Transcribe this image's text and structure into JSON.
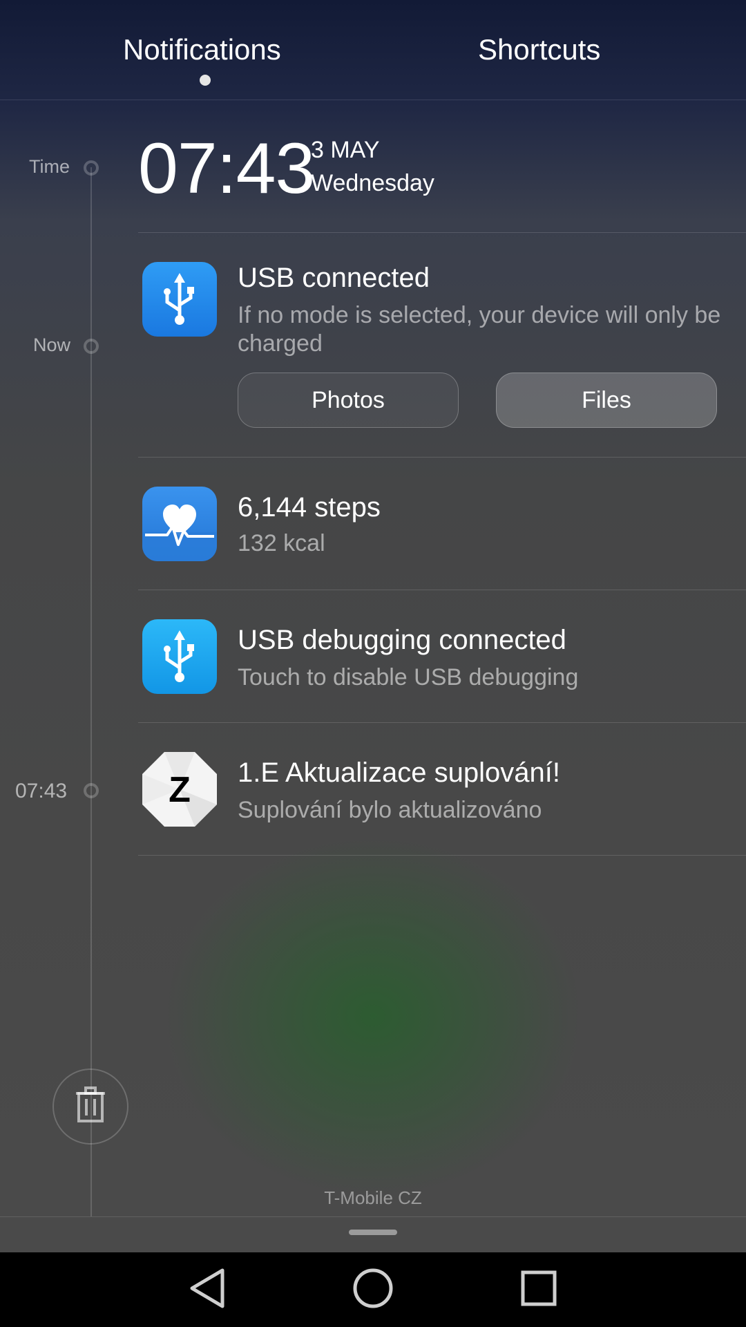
{
  "tabs": {
    "notifications": "Notifications",
    "shortcuts": "Shortcuts"
  },
  "timeline": {
    "time_label": "Time",
    "now_label": "Now",
    "entry_time": "07:43"
  },
  "clock": {
    "time": "07:43",
    "date": "3 MAY",
    "day": "Wednesday"
  },
  "notifications": [
    {
      "icon": "usb-icon",
      "title": "USB connected",
      "text": "If no mode is selected, your device will only be charged",
      "actions": [
        "Photos",
        "Files"
      ]
    },
    {
      "icon": "health-icon",
      "title": "6,144 steps",
      "text": "132 kcal"
    },
    {
      "icon": "usb-icon",
      "title": "USB debugging connected",
      "text": "Touch to disable USB debugging"
    },
    {
      "icon": "z-app-icon",
      "title": "1.E Aktualizace suplování!",
      "text": "Suplování bylo aktualizováno"
    }
  ],
  "carrier": "T-Mobile CZ",
  "colors": {
    "usb_blue": "#1a78e0",
    "debug_blue": "#1296e6",
    "nav_bar": "#000000"
  }
}
